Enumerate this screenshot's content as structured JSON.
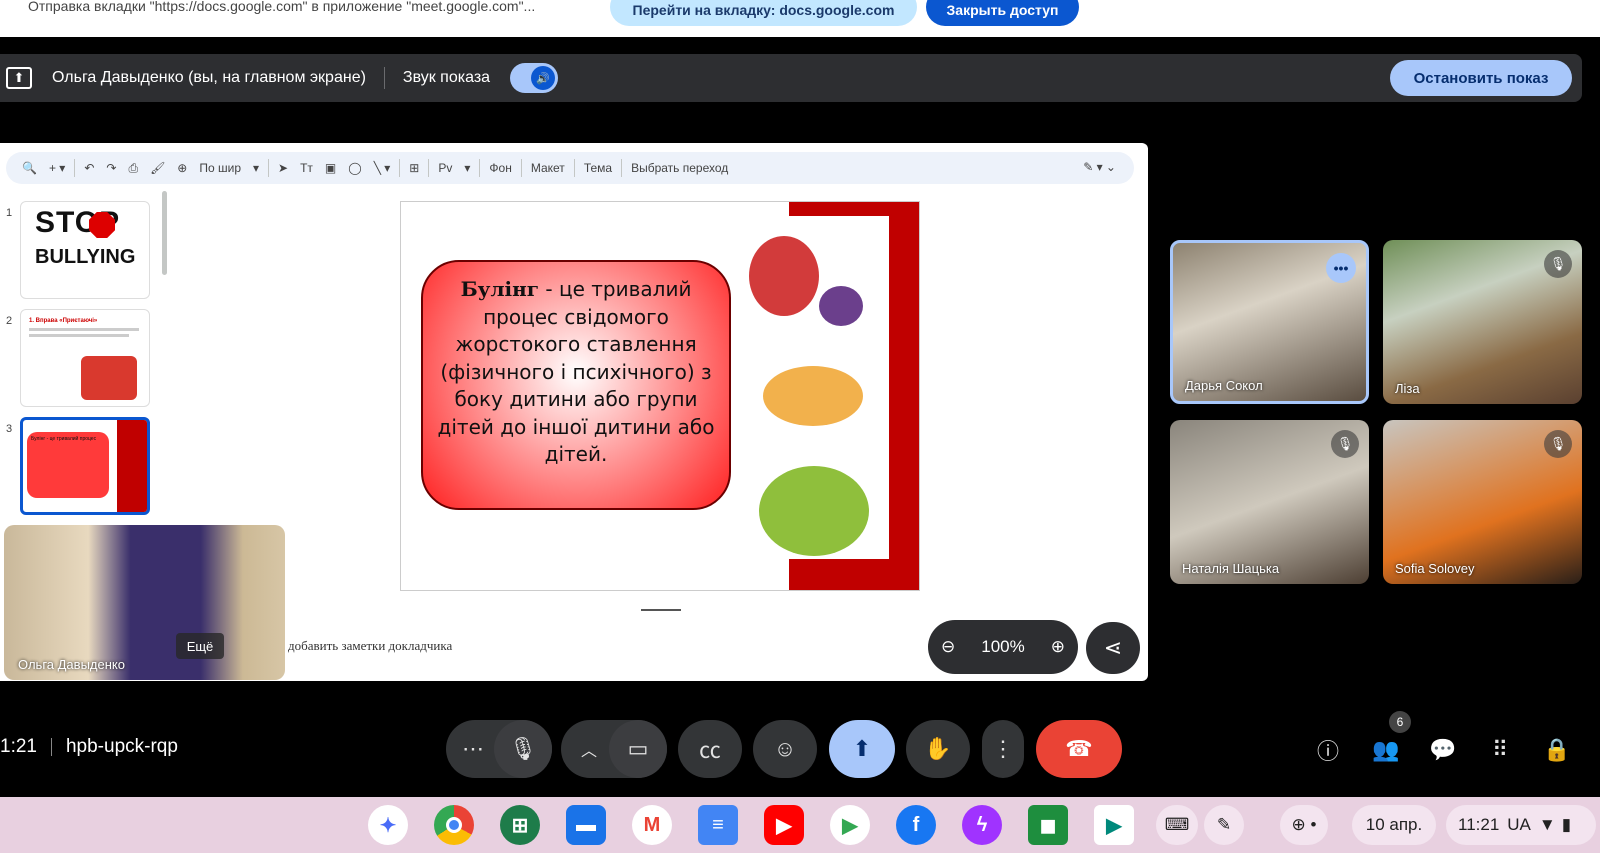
{
  "infobar": {
    "message": "Отправка вкладки \"https://docs.google.com\" в приложение \"meet.google.com\"...",
    "goto_tab": "Перейти на вкладку: docs.google.com",
    "close_access": "Закрыть доступ"
  },
  "sharebar": {
    "presenter": "Ольга Давыденко (вы, на главном экране)",
    "sound_label": "Звук показа",
    "stop_button": "Остановить показ"
  },
  "slides_toolbar": {
    "zoom_fit": "По шир",
    "font_size": "Рv",
    "background": "Фон",
    "layout": "Макет",
    "theme": "Тема",
    "transition": "Выбрать переход"
  },
  "thumbnails": [
    {
      "number": "1",
      "title_line1": "STOP",
      "title_line2": "BULLYING"
    },
    {
      "number": "2",
      "text": "1. Вправа «Приєтаючі»"
    },
    {
      "number": "3",
      "text": "Булінг - це тривалий процес"
    }
  ],
  "slide": {
    "term": "Булінг",
    "definition": " - це тривалий процес свідомого жорстокого ставлення (фізичного і психічного) з боку дитини або групи дітей до іншої дитини або дітей."
  },
  "speaker_notes_placeholder": "ы добавить заметки докладчика",
  "zoom": {
    "level": "100%"
  },
  "selfview": {
    "name": "Ольга Давыденко",
    "more_label": "Ещё"
  },
  "participants": [
    {
      "name": "Дарья Сокол",
      "pinned": true
    },
    {
      "name": "Ліза",
      "muted": true
    },
    {
      "name": "Наталія Шацька",
      "muted": true
    },
    {
      "name": "Sofia Solovey",
      "muted": true
    }
  ],
  "meeting": {
    "time": "1:21",
    "code": "hpb-upck-rqp",
    "people_count": "6"
  },
  "colors": {
    "end_call": "#ea4335",
    "present_active": "#a8c7fa",
    "accent": "#0b57d0"
  },
  "tray": {
    "date": "10 апр.",
    "clock": "11:21",
    "lang": "UA"
  },
  "apps": [
    "gemini-icon",
    "chrome-icon",
    "apps-icon",
    "files-icon",
    "gmail-icon",
    "docs-icon",
    "youtube-icon",
    "play-store-icon",
    "facebook-icon",
    "messenger-icon",
    "classroom-icon",
    "meet-icon"
  ]
}
